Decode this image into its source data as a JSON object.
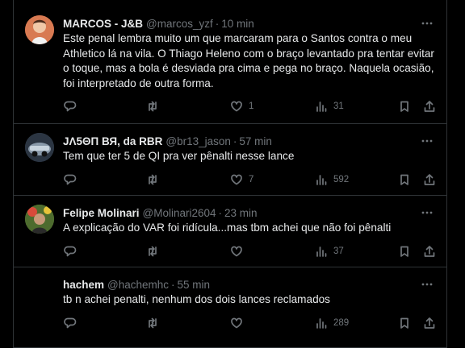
{
  "tweets": [
    {
      "name": "MARCOS - J&B",
      "handle": "@marcos_yzf",
      "time": "10 min",
      "text": "Este penal lembra muito um que marcaram para o Santos contra o meu Athletico lá na vila. O Thiago Heleno com o braço levantado pra tentar evitar o toque, mas a bola é desviada pra cima e pega no braço. Naquela ocasião, foi interpretado de outra forma.",
      "replies": "",
      "retweets": "",
      "likes": "1",
      "views": "31",
      "avatar_color": "#c25a3c"
    },
    {
      "name": "JΛ5ΘП ВЯ, da RBR",
      "handle": "@br13_jason",
      "time": "57 min",
      "text": "Tem que ter 5 de QI pra ver pênalti nesse lance",
      "replies": "",
      "retweets": "",
      "likes": "7",
      "views": "592",
      "avatar_color": "#3a4a5e"
    },
    {
      "name": "Felipe Molinari",
      "handle": "@Molinari2604",
      "time": "23 min",
      "text": "A explicação do VAR foi ridícula...mas tbm achei que não foi pênalti",
      "replies": "",
      "retweets": "",
      "likes": "",
      "views": "37",
      "avatar_color": "#6b8a3a"
    },
    {
      "name": "hachem",
      "handle": "@hachemhc",
      "time": "55 min",
      "text": "tb n achei penalti, nenhum dos dois lances reclamados",
      "replies": "",
      "retweets": "",
      "likes": "",
      "views": "289",
      "avatar_color": "#000000"
    }
  ],
  "separator": "·",
  "icons": {
    "reply": "reply-icon",
    "retweet": "retweet-icon",
    "like": "heart-icon",
    "views": "views-icon",
    "bookmark": "bookmark-icon",
    "share": "share-icon",
    "more": "more-icon"
  }
}
